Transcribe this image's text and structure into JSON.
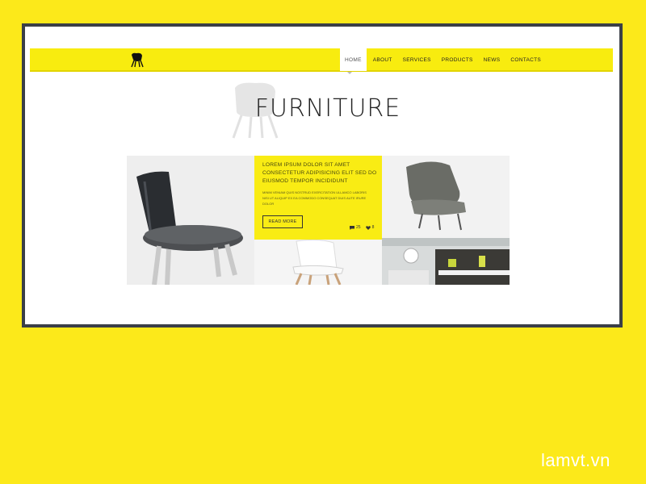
{
  "nav": {
    "items": [
      {
        "label": "HOME",
        "active": true
      },
      {
        "label": "ABOUT",
        "active": false
      },
      {
        "label": "SERVICES",
        "active": false
      },
      {
        "label": "PRODUCTS",
        "active": false
      },
      {
        "label": "NEWS",
        "active": false
      },
      {
        "label": "CONTACTS",
        "active": false
      }
    ]
  },
  "logo": {
    "icon": "chair-logo-icon"
  },
  "hero": {
    "title": "FURNITURE"
  },
  "promo": {
    "heading": "LOREM IPSUM DOLOR SIT AMET CONSECTETUR ADIPISICING ELIT SED DO EIUSMOD TEMPOR INCIDIDUNT",
    "body": "MINIM VENIAM QUIS NOSTRUD EXERCITATION ULLAMCO LABORIS NISI UT ALIQUIP EX EA COMMODO CONSEQUAT DUIS AUTE IRURE DOLOR",
    "button": "READ MORE",
    "comments": "25",
    "likes": "8"
  },
  "watermark": "lamvt.vn",
  "colors": {
    "background": "#FCE91A",
    "frame": "#3B3F47",
    "accent": "#F8EC0F"
  }
}
